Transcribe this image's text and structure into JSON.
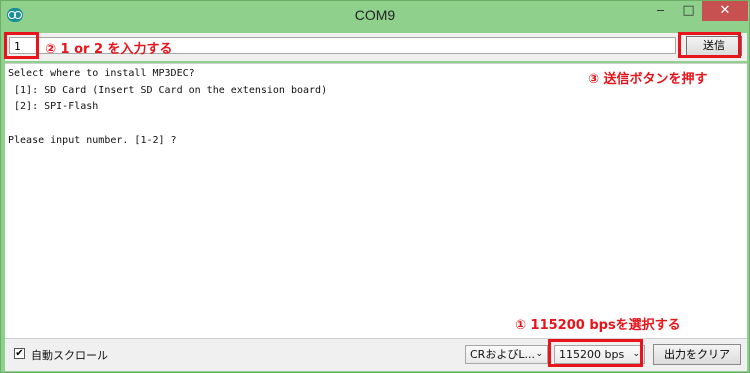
{
  "window": {
    "title": "COM9",
    "controls": {
      "minimize": "‒",
      "maximize": "□",
      "close": "✕"
    }
  },
  "input": {
    "value": "1",
    "send_label": "送信"
  },
  "console": {
    "lines": [
      "Select where to install MP3DEC?",
      " [1]: SD Card (Insert SD Card on the extension board)",
      " [2]: SPI-Flash",
      "",
      "Please input number. [1-2] ?"
    ]
  },
  "bottom": {
    "autoscroll_label": "自動スクロール",
    "autoscroll_checked": "✔",
    "line_ending": "CRおよびL...",
    "baud_rate": "115200 bps",
    "clear_label": "出力をクリア",
    "caret": "⌄"
  },
  "annotations": {
    "step1": "① 115200 bpsを選択する",
    "step2": "② 1 or 2 を入力する",
    "step3": "③ 送信ボタンを押す"
  },
  "colors": {
    "window_frame": "#8fd08c",
    "highlight": "#e8141b"
  }
}
